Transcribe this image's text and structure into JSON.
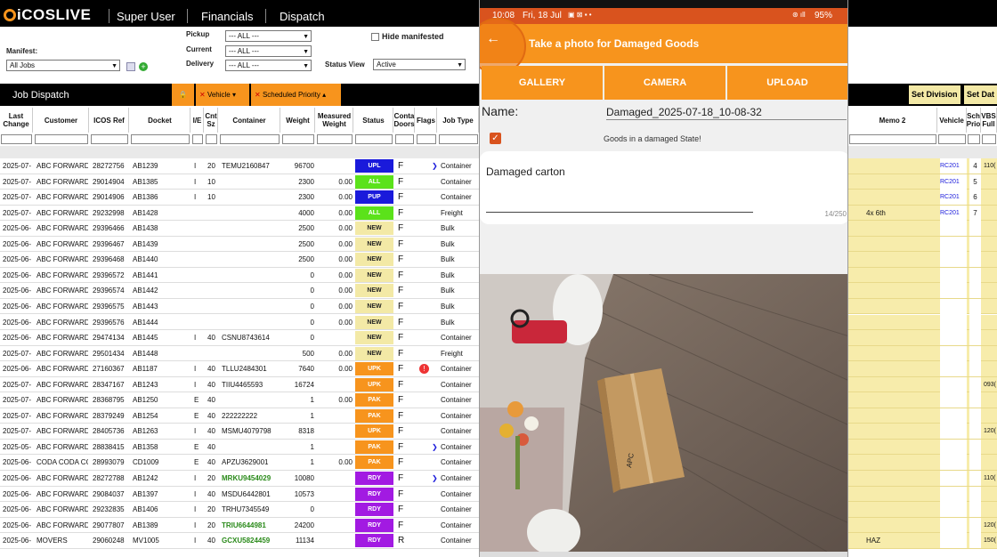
{
  "nav": {
    "logo": "iCOSLIVE",
    "items": [
      "Super User",
      "Financials",
      "Dispatch"
    ]
  },
  "filters": {
    "manifest_label": "Manifest:",
    "manifest_value": "All Jobs",
    "pickup_label": "Pickup",
    "pickup_value": "--- ALL ---",
    "current_label": "Current",
    "current_value": "--- ALL ---",
    "delivery_label": "Delivery",
    "delivery_value": "--- ALL ---",
    "hide_manifested": "Hide manifested",
    "status_view_label": "Status View",
    "status_view_value": "Active"
  },
  "dispatch": {
    "title": "Job Dispatch",
    "vehicle": "Vehicle",
    "scheduled_priority": "Scheduled Priority",
    "set_division": "Set Division",
    "set_date": "Set Dat"
  },
  "columns": [
    "Last Change",
    "Customer",
    "ICOS Ref",
    "Docket",
    "I/E",
    "Cnt Sz",
    "Container",
    "Weight",
    "Measured Weight",
    "Status",
    "Conta Doors",
    "Flags",
    "Job Type"
  ],
  "right_columns": [
    "Memo 2",
    "Vehicle",
    "Sch Prio",
    "VBS Full"
  ],
  "rows": [
    {
      "date": "2025-07-",
      "customer": "ABC FORWARDII",
      "ref": "28272756",
      "docket": "AB1239",
      "ie": "I",
      "sz": "20",
      "container": "TEMU2160847",
      "weight": "96700",
      "mweight": "",
      "status": "UPL",
      "scolor": "#1a1adb",
      "door": "F",
      "flag": "arrow",
      "type": "Container",
      "memo": "",
      "vehicle": "RC201",
      "prio": "4",
      "vbs": "110("
    },
    {
      "date": "2025-07-",
      "customer": "ABC FORWARDII",
      "ref": "29014904",
      "docket": "AB1385",
      "ie": "I",
      "sz": "10",
      "container": "",
      "weight": "2300",
      "mweight": "0.00",
      "status": "ALL",
      "scolor": "#5be21a",
      "door": "F",
      "flag": "",
      "type": "Container",
      "memo": "",
      "vehicle": "RC201",
      "prio": "5",
      "vbs": ""
    },
    {
      "date": "2025-07-",
      "customer": "ABC FORWARDII",
      "ref": "29014906",
      "docket": "AB1386",
      "ie": "I",
      "sz": "10",
      "container": "",
      "weight": "2300",
      "mweight": "0.00",
      "status": "PUP",
      "scolor": "#1a1adb",
      "door": "F",
      "flag": "",
      "type": "Container",
      "memo": "",
      "vehicle": "RC201",
      "prio": "6",
      "vbs": ""
    },
    {
      "date": "2025-07-",
      "customer": "ABC FORWARDII",
      "ref": "29232998",
      "docket": "AB1428",
      "ie": "",
      "sz": "",
      "container": "",
      "weight": "4000",
      "mweight": "0.00",
      "status": "ALL",
      "scolor": "#5be21a",
      "door": "F",
      "flag": "",
      "type": "Freight",
      "memo": "4x 6th",
      "vehicle": "RC201",
      "prio": "7",
      "vbs": ""
    },
    {
      "date": "2025-06-",
      "customer": "ABC FORWARDII",
      "ref": "29396466",
      "docket": "AB1438",
      "ie": "",
      "sz": "",
      "container": "",
      "weight": "2500",
      "mweight": "0.00",
      "status": "NEW",
      "scolor": "#f3e9a6",
      "door": "F",
      "flag": "",
      "type": "Bulk",
      "memo": "",
      "vehicle": "",
      "prio": "",
      "vbs": ""
    },
    {
      "date": "2025-06-",
      "customer": "ABC FORWARDII",
      "ref": "29396467",
      "docket": "AB1439",
      "ie": "",
      "sz": "",
      "container": "",
      "weight": "2500",
      "mweight": "0.00",
      "status": "NEW",
      "scolor": "#f3e9a6",
      "door": "F",
      "flag": "",
      "type": "Bulk",
      "memo": "",
      "vehicle": "",
      "prio": "",
      "vbs": ""
    },
    {
      "date": "2025-06-",
      "customer": "ABC FORWARDII",
      "ref": "29396468",
      "docket": "AB1440",
      "ie": "",
      "sz": "",
      "container": "",
      "weight": "2500",
      "mweight": "0.00",
      "status": "NEW",
      "scolor": "#f3e9a6",
      "door": "F",
      "flag": "",
      "type": "Bulk",
      "memo": "",
      "vehicle": "",
      "prio": "",
      "vbs": ""
    },
    {
      "date": "2025-06-",
      "customer": "ABC FORWARDII",
      "ref": "29396572",
      "docket": "AB1441",
      "ie": "",
      "sz": "",
      "container": "",
      "weight": "0",
      "mweight": "0.00",
      "status": "NEW",
      "scolor": "#f3e9a6",
      "door": "F",
      "flag": "",
      "type": "Bulk",
      "memo": "",
      "vehicle": "",
      "prio": "",
      "vbs": ""
    },
    {
      "date": "2025-06-",
      "customer": "ABC FORWARDII",
      "ref": "29396574",
      "docket": "AB1442",
      "ie": "",
      "sz": "",
      "container": "",
      "weight": "0",
      "mweight": "0.00",
      "status": "NEW",
      "scolor": "#f3e9a6",
      "door": "F",
      "flag": "",
      "type": "Bulk",
      "memo": "",
      "vehicle": "",
      "prio": "",
      "vbs": ""
    },
    {
      "date": "2025-06-",
      "customer": "ABC FORWARDII",
      "ref": "29396575",
      "docket": "AB1443",
      "ie": "",
      "sz": "",
      "container": "",
      "weight": "0",
      "mweight": "0.00",
      "status": "NEW",
      "scolor": "#f3e9a6",
      "door": "F",
      "flag": "",
      "type": "Bulk",
      "memo": "",
      "vehicle": "",
      "prio": "",
      "vbs": ""
    },
    {
      "date": "2025-06-",
      "customer": "ABC FORWARDII",
      "ref": "29396576",
      "docket": "AB1444",
      "ie": "",
      "sz": "",
      "container": "",
      "weight": "0",
      "mweight": "0.00",
      "status": "NEW",
      "scolor": "#f3e9a6",
      "door": "F",
      "flag": "",
      "type": "Bulk",
      "memo": "",
      "vehicle": "",
      "prio": "",
      "vbs": ""
    },
    {
      "date": "2025-06-",
      "customer": "ABC FORWARDII",
      "ref": "29474134",
      "docket": "AB1445",
      "ie": "I",
      "sz": "40",
      "container": "CSNU8743614",
      "weight": "0",
      "mweight": "",
      "status": "NEW",
      "scolor": "#f3e9a6",
      "door": "F",
      "flag": "",
      "type": "Container",
      "memo": "",
      "vehicle": "",
      "prio": "",
      "vbs": ""
    },
    {
      "date": "2025-07-",
      "customer": "ABC FORWARDII",
      "ref": "29501434",
      "docket": "AB1448",
      "ie": "",
      "sz": "",
      "container": "",
      "weight": "500",
      "mweight": "0.00",
      "status": "NEW",
      "scolor": "#f3e9a6",
      "door": "F",
      "flag": "",
      "type": "Freight",
      "memo": "",
      "vehicle": "",
      "prio": "",
      "vbs": ""
    },
    {
      "date": "2025-06-",
      "customer": "ABC FORWARDII",
      "ref": "27160367",
      "docket": "AB1187",
      "ie": "I",
      "sz": "40",
      "container": "TLLU2484301",
      "weight": "7640",
      "mweight": "0.00",
      "status": "UPK",
      "scolor": "#f7941d",
      "door": "F",
      "flag": "alert",
      "type": "Container",
      "memo": "",
      "vehicle": "",
      "prio": "",
      "vbs": ""
    },
    {
      "date": "2025-07-",
      "customer": "ABC FORWARDII",
      "ref": "28347167",
      "docket": "AB1243",
      "ie": "I",
      "sz": "40",
      "container": "TIIU4465593",
      "weight": "16724",
      "mweight": "",
      "status": "UPK",
      "scolor": "#f7941d",
      "door": "F",
      "flag": "",
      "type": "Container",
      "memo": "",
      "vehicle": "",
      "prio": "",
      "vbs": "093("
    },
    {
      "date": "2025-07-",
      "customer": "ABC FORWARDII",
      "ref": "28368795",
      "docket": "AB1250",
      "ie": "E",
      "sz": "40",
      "container": "",
      "weight": "1",
      "mweight": "0.00",
      "status": "PAK",
      "scolor": "#f7941d",
      "door": "F",
      "flag": "",
      "type": "Container",
      "memo": "",
      "vehicle": "",
      "prio": "",
      "vbs": ""
    },
    {
      "date": "2025-07-",
      "customer": "ABC FORWARDII",
      "ref": "28379249",
      "docket": "AB1254",
      "ie": "E",
      "sz": "40",
      "container": "222222222",
      "weight": "1",
      "mweight": "",
      "status": "PAK",
      "scolor": "#f7941d",
      "door": "F",
      "flag": "",
      "type": "Container",
      "memo": "",
      "vehicle": "",
      "prio": "",
      "vbs": ""
    },
    {
      "date": "2025-07-",
      "customer": "ABC FORWARDII",
      "ref": "28405736",
      "docket": "AB1263",
      "ie": "I",
      "sz": "40",
      "container": "MSMU4079798",
      "weight": "8318",
      "mweight": "",
      "status": "UPK",
      "scolor": "#f7941d",
      "door": "F",
      "flag": "",
      "type": "Container",
      "memo": "",
      "vehicle": "",
      "prio": "",
      "vbs": "120("
    },
    {
      "date": "2025-05-",
      "customer": "ABC FORWARDII",
      "ref": "28838415",
      "docket": "AB1358",
      "ie": "E",
      "sz": "40",
      "container": "",
      "weight": "1",
      "mweight": "",
      "status": "PAK",
      "scolor": "#f7941d",
      "door": "F",
      "flag": "arrow",
      "type": "Container",
      "memo": "",
      "vehicle": "",
      "prio": "",
      "vbs": ""
    },
    {
      "date": "2025-06-",
      "customer": "CODA CODA COI",
      "ref": "28993079",
      "docket": "CD1009",
      "ie": "E",
      "sz": "40",
      "container": "APZU3629001",
      "weight": "1",
      "mweight": "0.00",
      "status": "PAK",
      "scolor": "#f7941d",
      "door": "F",
      "flag": "",
      "type": "Container",
      "memo": "",
      "vehicle": "",
      "prio": "",
      "vbs": ""
    },
    {
      "date": "2025-06-",
      "customer": "ABC FORWARDII",
      "ref": "28272788",
      "docket": "AB1242",
      "ie": "I",
      "sz": "20",
      "container": "MRKU9454029",
      "weight": "10080",
      "mweight": "",
      "status": "RDY",
      "scolor": "#a21ae2",
      "door": "F",
      "flag": "arrow",
      "type": "Container",
      "memo": "",
      "vehicle": "",
      "prio": "",
      "vbs": "110("
    },
    {
      "date": "2025-06-",
      "customer": "ABC FORWARDII",
      "ref": "29084037",
      "docket": "AB1397",
      "ie": "I",
      "sz": "40",
      "container": "MSDU6442801",
      "weight": "10573",
      "mweight": "",
      "status": "RDY",
      "scolor": "#a21ae2",
      "door": "F",
      "flag": "",
      "type": "Container",
      "memo": "",
      "vehicle": "",
      "prio": "",
      "vbs": ""
    },
    {
      "date": "2025-06-",
      "customer": "ABC FORWARDII",
      "ref": "29232835",
      "docket": "AB1406",
      "ie": "I",
      "sz": "20",
      "container": "TRHU7345549",
      "weight": "0",
      "mweight": "",
      "status": "RDY",
      "scolor": "#a21ae2",
      "door": "F",
      "flag": "",
      "type": "Container",
      "memo": "",
      "vehicle": "",
      "prio": "",
      "vbs": ""
    },
    {
      "date": "2025-06-",
      "customer": "ABC FORWARDII",
      "ref": "29077807",
      "docket": "AB1389",
      "ie": "I",
      "sz": "20",
      "container": "TRIU6644981",
      "weight": "24200",
      "mweight": "",
      "status": "RDY",
      "scolor": "#a21ae2",
      "door": "F",
      "flag": "",
      "type": "Container",
      "memo": "",
      "vehicle": "",
      "prio": "",
      "vbs": "120("
    },
    {
      "date": "2025-06-",
      "customer": "MOVERS",
      "ref": "29060248",
      "docket": "MV1005",
      "ie": "I",
      "sz": "40",
      "container": "GCXU5824459",
      "weight": "11134",
      "mweight": "",
      "status": "RDY",
      "scolor": "#a21ae2",
      "door": "R",
      "flag": "",
      "type": "Container",
      "memo": "HAZ",
      "vehicle": "",
      "prio": "",
      "vbs": "150("
    }
  ],
  "green_containers": [
    "MRKU9454029",
    "TRIU6644981",
    "GCXU5824459"
  ],
  "phone": {
    "time": "10:08",
    "date": "Fri, 18 Jul",
    "battery": "95%",
    "title": "Take a photo for Damaged Goods",
    "gallery": "GALLERY",
    "camera": "CAMERA",
    "upload": "UPLOAD",
    "name_label": "Name:",
    "name_value": "Damaged_2025-07-18_10-08-32",
    "checkbox_label": "Goods in a damaged State!",
    "note": "Damaged carton",
    "note_count": "14/250",
    "box_brand": "APC"
  }
}
